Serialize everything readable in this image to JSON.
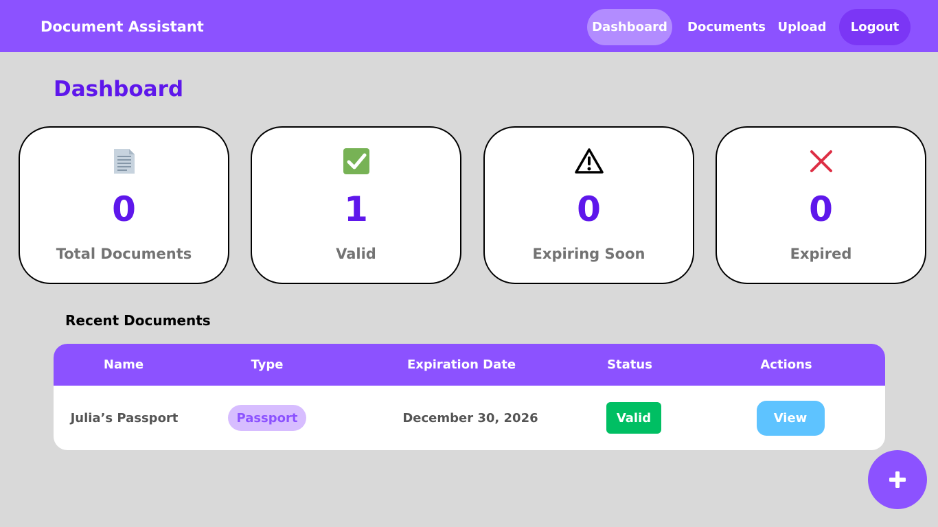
{
  "header": {
    "brand": "Document Assistant",
    "nav": {
      "dashboard": "Dashboard",
      "documents": "Documents",
      "upload": "Upload",
      "logout": "Logout"
    },
    "active_nav": "Dashboard"
  },
  "page_title": "Dashboard",
  "stats": [
    {
      "icon": "document-icon",
      "value": "0",
      "label": "Total Documents"
    },
    {
      "icon": "check-icon",
      "value": "1",
      "label": "Valid"
    },
    {
      "icon": "warning-icon",
      "value": "0",
      "label": "Expiring Soon"
    },
    {
      "icon": "cross-icon",
      "value": "0",
      "label": "Expired"
    }
  ],
  "recent": {
    "title": "Recent Documents",
    "columns": [
      "Name",
      "Type",
      "Expiration Date",
      "Status",
      "Actions"
    ],
    "rows": [
      {
        "name": "Julia’s Passport",
        "type": "Passport",
        "expiration": "December 30, 2026",
        "status": "Valid",
        "action": "View"
      }
    ]
  },
  "fab": {
    "icon": "plus-icon"
  },
  "colors": {
    "primary": "#8c52ff",
    "accent_text": "#5e17eb",
    "valid": "#00bf63",
    "view_button": "#5ec3ff",
    "background": "#d9d9d9"
  }
}
